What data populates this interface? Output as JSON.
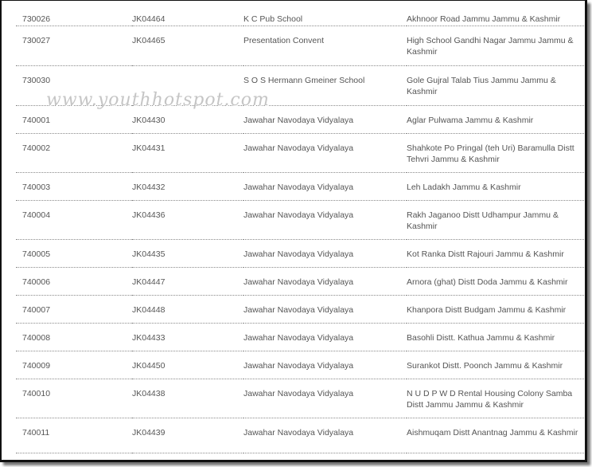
{
  "watermark": "www.youthhotspot.com",
  "rows": [
    {
      "code": "730026",
      "id": "JK04464",
      "name": "K C Pub School",
      "address": "Akhnoor Road Jammu Jammu & Kashmir"
    },
    {
      "code": "730027",
      "id": "JK04465",
      "name": "Presentation Convent",
      "address": "High School Gandhi Nagar Jammu Jammu & Kashmir"
    },
    {
      "code": "730030",
      "id": "",
      "name": "S O S Hermann Gmeiner School",
      "address": "Gole Gujral Talab Tius Jammu Jammu & Kashmir"
    },
    {
      "code": "740001",
      "id": "JK04430",
      "name": "Jawahar Navodaya Vidyalaya",
      "address": "Aglar Pulwama Jammu & Kashmir"
    },
    {
      "code": "740002",
      "id": "JK04431",
      "name": "Jawahar Navodaya Vidyalaya",
      "address": "Shahkote Po Pringal (teh Uri) Baramulla Distt Tehvri Jammu & Kashmir"
    },
    {
      "code": "740003",
      "id": "JK04432",
      "name": "Jawahar Navodaya Vidyalaya",
      "address": "Leh Ladakh Jammu & Kashmir"
    },
    {
      "code": "740004",
      "id": "JK04436",
      "name": "Jawahar Navodaya Vidyalaya",
      "address": "Rakh Jaganoo Distt Udhampur Jammu & Kashmir"
    },
    {
      "code": "740005",
      "id": "JK04435",
      "name": "Jawahar Navodaya Vidyalaya",
      "address": "Kot Ranka Distt Rajouri Jammu & Kashmir"
    },
    {
      "code": "740006",
      "id": "JK04447",
      "name": "Jawahar Navodaya Vidyalaya",
      "address": "Arnora (ghat) Distt Doda Jammu & Kashmir"
    },
    {
      "code": "740007",
      "id": "JK04448",
      "name": "Jawahar Navodaya Vidyalaya",
      "address": "Khanpora Distt Budgam Jammu & Kashmir"
    },
    {
      "code": "740008",
      "id": "JK04433",
      "name": "Jawahar Navodaya Vidyalaya",
      "address": "Basohli Distt. Kathua Jammu & Kashmir"
    },
    {
      "code": "740009",
      "id": "JK04450",
      "name": "Jawahar Navodaya Vidyalaya",
      "address": "Surankot Distt. Poonch Jammu & Kashmir"
    },
    {
      "code": "740010",
      "id": "JK04438",
      "name": "Jawahar Navodaya Vidyalaya",
      "address": "N U D P W D Rental Housing Colony Samba Distt Jammu Jammu & Kashmir"
    },
    {
      "code": "740011",
      "id": "JK04439",
      "name": "Jawahar Navodaya Vidyalaya",
      "address": "Aishmuqam Distt Anantnag Jammu & Kashmir"
    }
  ]
}
